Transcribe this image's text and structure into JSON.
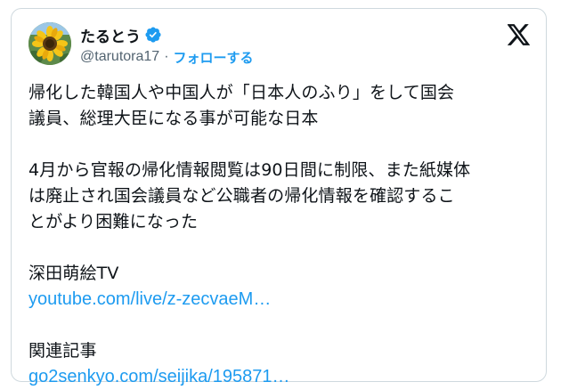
{
  "author": {
    "display_name": "たるとう",
    "handle": "@tarutora17",
    "separator": "·",
    "follow_label": "フォローする",
    "verified_icon": "verified-badge-icon",
    "verified_color": "#1d9bf0",
    "avatar_description_icon": "sunflower-avatar"
  },
  "brand": {
    "logo_icon": "x-logo-icon"
  },
  "tweet": {
    "line1": "帰化した韓国人や中国人が「日本人のふり」をして国会",
    "line2": "議員、総理大臣になる事が可能な日本",
    "line3": "4月から官報の帰化情報閲覧は90日間に制限、また紙媒体",
    "line4": "は廃止され国会議員など公職者の帰化情報を確認するこ",
    "line5": "とがより困難になった",
    "source1_label": "深田萌絵TV",
    "source1_link": "youtube.com/live/z-zecvaeM…",
    "source2_label": "関連記事",
    "source2_link": "go2senkyo.com/seijika/195871…"
  },
  "colors": {
    "text": "#0f1419",
    "secondary": "#536471",
    "accent": "#1d9bf0",
    "border": "#cfd9de"
  }
}
